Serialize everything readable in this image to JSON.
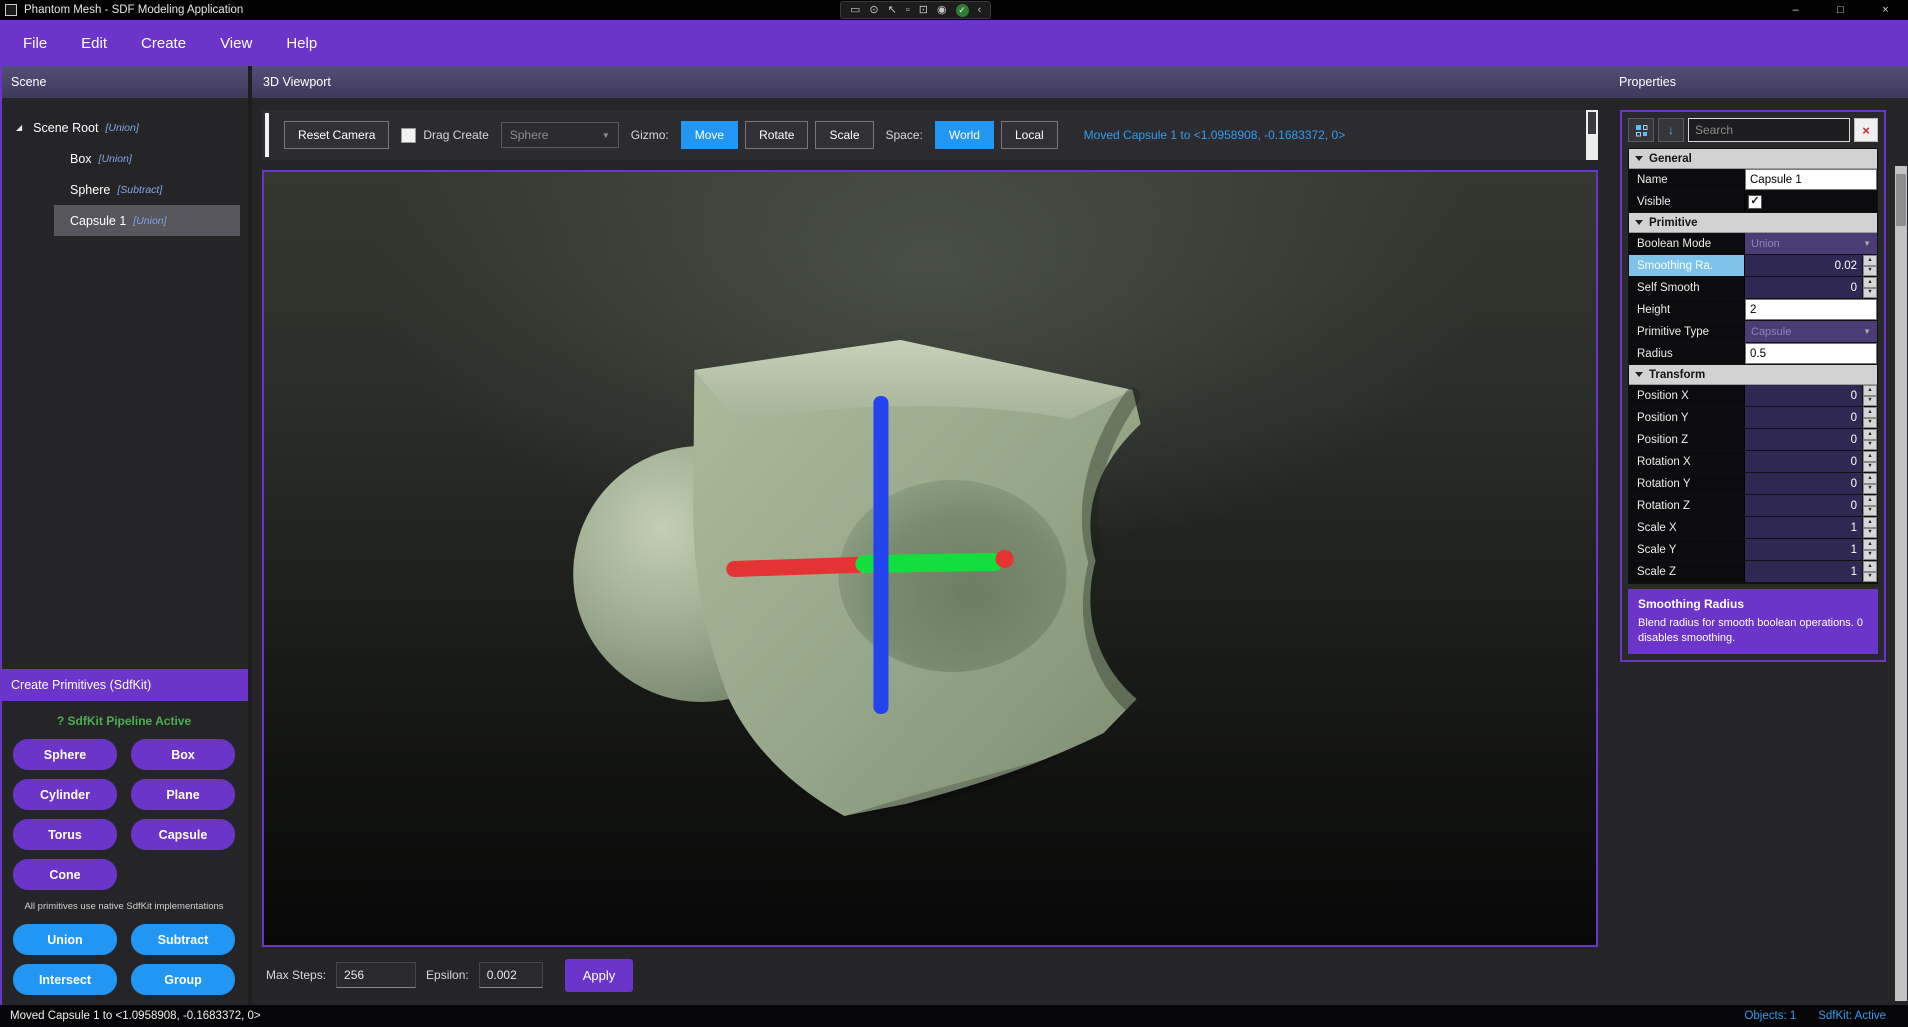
{
  "icons": {
    "check": "✓",
    "close": "×",
    "minimize": "–",
    "maximize": "□",
    "chevron_down": "▼",
    "spin_up": "▲",
    "spin_down": "▼",
    "expander": "◢",
    "sort_arrow": "↓"
  },
  "colors": {
    "accent_purple": "#6a35c8",
    "accent_blue": "#2196f3",
    "selected_row_blue": "#7ec3ea",
    "status_green": "#4caf50",
    "object_green": "#9aa98c"
  },
  "title_bar": {
    "app_title": "Phantom Mesh - SDF Modeling Application",
    "capture_icons": [
      {
        "name": "display-share-icon",
        "glyph": "▭"
      },
      {
        "name": "camera-icon",
        "glyph": "⊙"
      },
      {
        "name": "cursor-icon",
        "glyph": "↖"
      },
      {
        "name": "region-select-icon",
        "glyph": "▫"
      },
      {
        "name": "cursor-region-icon",
        "glyph": "⊡"
      },
      {
        "name": "record-icon",
        "glyph": "◉"
      },
      {
        "name": "status-ready-icon",
        "glyph": "✓",
        "bg": "#2e7d32",
        "color": "#ffffff"
      },
      {
        "name": "collapse-chevron-icon",
        "glyph": "‹"
      }
    ]
  },
  "menu": {
    "items": [
      {
        "label": "File"
      },
      {
        "label": "Edit"
      },
      {
        "label": "Create"
      },
      {
        "label": "View"
      },
      {
        "label": "Help"
      }
    ]
  },
  "scene_panel": {
    "title": "Scene",
    "tree": [
      {
        "label": "Scene Root",
        "badge": "[Union]",
        "level": 0,
        "selected": false
      },
      {
        "label": "Box",
        "badge": "[Union]",
        "level": 1,
        "selected": false
      },
      {
        "label": "Sphere",
        "badge": "[Subtract]",
        "level": 1,
        "selected": false
      },
      {
        "label": "Capsule 1",
        "badge": "[Union]",
        "level": 1,
        "selected": true
      }
    ]
  },
  "primitives_panel": {
    "title": "Create Primitives (SdfKit)",
    "status": "? SdfKit Pipeline Active",
    "primitive_buttons": [
      "Sphere",
      "Box",
      "Cylinder",
      "Plane",
      "Torus",
      "Capsule",
      "Cone"
    ],
    "note": "All primitives use native SdfKit implementations",
    "boolean_buttons": [
      "Union",
      "Subtract",
      "Intersect",
      "Group"
    ]
  },
  "viewport_panel": {
    "title": "3D Viewport",
    "toolbar": {
      "reset_camera": "Reset Camera",
      "drag_create_label": "Drag Create",
      "drag_create_checked": false,
      "shape_dropdown_value": "Sphere",
      "gizmo_label": "Gizmo:",
      "gizmo_modes": [
        {
          "label": "Move",
          "active": true
        },
        {
          "label": "Rotate",
          "active": false
        },
        {
          "label": "Scale",
          "active": false
        }
      ],
      "space_label": "Space:",
      "space_modes": [
        {
          "label": "World",
          "active": true
        },
        {
          "label": "Local",
          "active": false
        }
      ],
      "status_message": "Moved Capsule 1 to <1.0958908, -0.1683372, 0>"
    },
    "footer": {
      "max_steps_label": "Max Steps:",
      "max_steps_value": "256",
      "epsilon_label": "Epsilon:",
      "epsilon_value": "0.002",
      "apply_label": "Apply"
    },
    "gizmo_colors": {
      "x_axis": "#e53232",
      "y_axis": "#2343ee",
      "z_axis": "#12df3e"
    }
  },
  "properties_panel": {
    "title": "Properties",
    "search_placeholder": "Search",
    "rows": [
      {
        "type": "category",
        "label": "General"
      },
      {
        "type": "text",
        "label": "Name",
        "value": "Capsule 1"
      },
      {
        "type": "checkbox",
        "label": "Visible",
        "checked": true
      },
      {
        "type": "category",
        "label": "Primitive"
      },
      {
        "type": "dropdown",
        "label": "Boolean Mode",
        "value": "Union"
      },
      {
        "type": "spinner",
        "label": "Smoothing Ra.",
        "value": "0.02",
        "selected": true
      },
      {
        "type": "spinner",
        "label": "Self Smooth",
        "value": "0"
      },
      {
        "type": "text",
        "label": "Height",
        "value": "2"
      },
      {
        "type": "dropdown",
        "label": "Primitive Type",
        "value": "Capsule"
      },
      {
        "type": "text",
        "label": "Radius",
        "value": "0.5"
      },
      {
        "type": "category",
        "label": "Transform"
      },
      {
        "type": "spinner",
        "label": "Position X",
        "value": "0"
      },
      {
        "type": "spinner",
        "label": "Position Y",
        "value": "0"
      },
      {
        "type": "spinner",
        "label": "Position Z",
        "value": "0"
      },
      {
        "type": "spinner",
        "label": "Rotation X",
        "value": "0"
      },
      {
        "type": "spinner",
        "label": "Rotation Y",
        "value": "0"
      },
      {
        "type": "spinner",
        "label": "Rotation Z",
        "value": "0"
      },
      {
        "type": "spinner",
        "label": "Scale X",
        "value": "1"
      },
      {
        "type": "spinner",
        "label": "Scale Y",
        "value": "1"
      },
      {
        "type": "spinner",
        "label": "Scale Z",
        "value": "1"
      }
    ],
    "description": {
      "title": "Smoothing Radius",
      "text": "Blend radius for smooth boolean operations. 0 disables smoothing."
    }
  },
  "status_bar": {
    "message": "Moved Capsule 1 to <1.0958908, -0.1683372, 0>",
    "objects": "Objects: 1",
    "sdfkit": "SdfKit: Active"
  }
}
